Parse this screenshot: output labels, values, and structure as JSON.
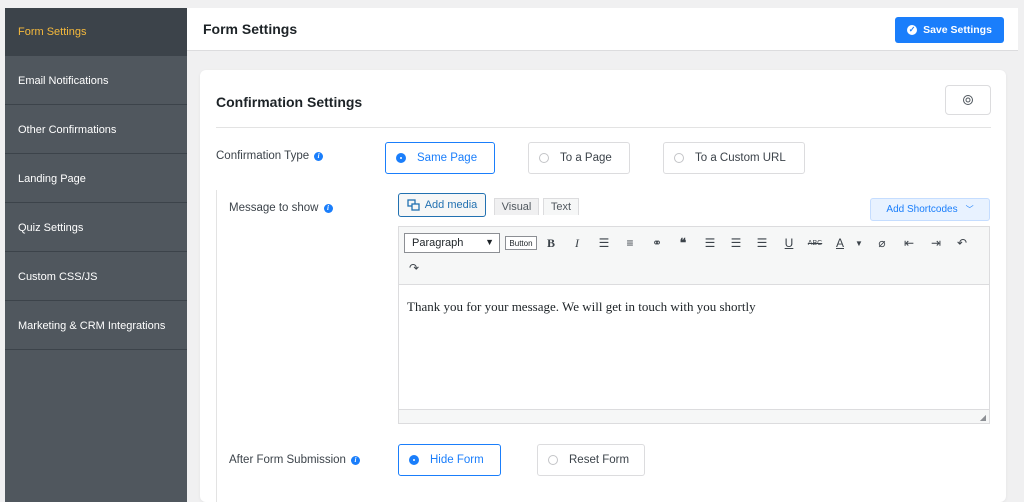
{
  "sidebar": {
    "items": [
      {
        "label": "Form Settings"
      },
      {
        "label": "Email Notifications"
      },
      {
        "label": "Other Confirmations"
      },
      {
        "label": "Landing Page"
      },
      {
        "label": "Quiz Settings"
      },
      {
        "label": "Custom CSS/JS"
      },
      {
        "label": "Marketing & CRM Integrations"
      }
    ],
    "active_index": 0
  },
  "header": {
    "title": "Form Settings",
    "save_label": "Save Settings"
  },
  "card": {
    "title": "Confirmation Settings",
    "help_icon": "globe-icon"
  },
  "confirmation_type": {
    "label": "Confirmation Type",
    "options": [
      {
        "label": "Same Page",
        "selected": true
      },
      {
        "label": "To a Page",
        "selected": false
      },
      {
        "label": "To a Custom URL",
        "selected": false
      }
    ]
  },
  "message": {
    "label": "Message to show",
    "add_media_label": "Add media",
    "tabs": [
      {
        "label": "Visual"
      },
      {
        "label": "Text"
      }
    ],
    "shortcodes_label": "Add Shortcodes",
    "format_value": "Paragraph",
    "button_label": "Button",
    "toolbar_icons": [
      "bold-icon",
      "italic-icon",
      "bullet-list-icon",
      "numbered-list-icon",
      "link-icon",
      "blockquote-icon",
      "align-left-icon",
      "align-center-icon",
      "align-right-icon",
      "underline-icon",
      "strikethrough-icon",
      "text-color-icon",
      "eraser-icon",
      "outdent-icon",
      "indent-icon",
      "undo-icon",
      "redo-icon"
    ],
    "content": "Thank you for your message. We will get in touch with you shortly"
  },
  "after_submission": {
    "label": "After Form Submission",
    "options": [
      {
        "label": "Hide Form",
        "selected": true
      },
      {
        "label": "Reset Form",
        "selected": false
      }
    ]
  },
  "colors": {
    "accent": "#1a7efb",
    "sidebar_bg": "#50575e",
    "sidebar_active_text": "#f5b93c"
  }
}
